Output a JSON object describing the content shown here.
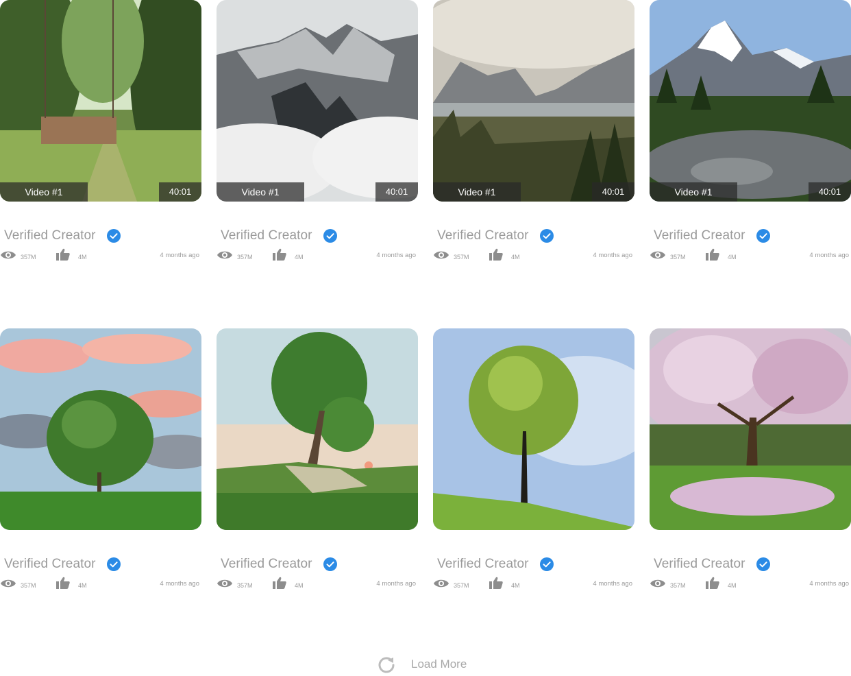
{
  "colors": {
    "text_muted": "#9a9a9a",
    "verified": "#2b8be6",
    "overlay": "#282828"
  },
  "cards": [
    {
      "scene": "garden-swing",
      "title": "Video #1",
      "duration": "40:01",
      "creator": "Verified Creator",
      "views": "357M",
      "likes": "4M",
      "age": "4 months ago"
    },
    {
      "scene": "misty-mountains",
      "title": "Video #1",
      "duration": "40:01",
      "creator": "Verified Creator",
      "views": "357M",
      "likes": "4M",
      "age": "4 months ago"
    },
    {
      "scene": "mountain-lake",
      "title": "Video #1",
      "duration": "40:01",
      "creator": "Verified Creator",
      "views": "357M",
      "likes": "4M",
      "age": "4 months ago"
    },
    {
      "scene": "alpine-peak",
      "title": "Video #1",
      "duration": "40:01",
      "creator": "Verified Creator",
      "views": "357M",
      "likes": "4M",
      "age": "4 months ago"
    },
    {
      "scene": "tree-pink-clouds",
      "creator": "Verified Creator",
      "views": "357M",
      "likes": "4M",
      "age": "4 months ago"
    },
    {
      "scene": "tree-hill-sunset",
      "creator": "Verified Creator",
      "views": "357M",
      "likes": "4M",
      "age": "4 months ago"
    },
    {
      "scene": "tree-blue-sky",
      "creator": "Verified Creator",
      "views": "357M",
      "likes": "4M",
      "age": "4 months ago"
    },
    {
      "scene": "cherry-blossom",
      "creator": "Verified Creator",
      "views": "357M",
      "likes": "4M",
      "age": "4 months ago"
    }
  ],
  "load_more": {
    "label": "Load More",
    "icon": "refresh-icon"
  }
}
